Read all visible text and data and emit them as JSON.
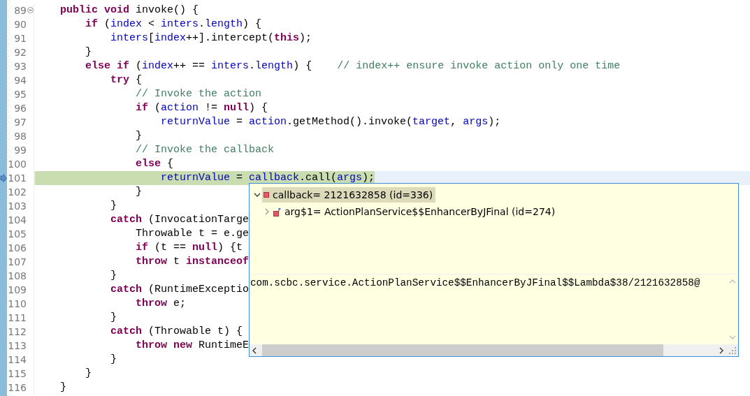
{
  "editor": {
    "lines": [
      {
        "number": "89",
        "fold": true,
        "current": false,
        "tokens": [
          {
            "kind": "kw",
            "text": "    public void"
          },
          {
            "kind": "plain",
            "text": " invoke() {"
          }
        ]
      },
      {
        "number": "90",
        "fold": false,
        "current": false,
        "tokens": [
          {
            "kind": "kw",
            "text": "        if"
          },
          {
            "kind": "plain",
            "text": " ("
          },
          {
            "kind": "field",
            "text": "index"
          },
          {
            "kind": "plain",
            "text": " < "
          },
          {
            "kind": "field",
            "text": "inters"
          },
          {
            "kind": "plain",
            "text": "."
          },
          {
            "kind": "field",
            "text": "length"
          },
          {
            "kind": "plain",
            "text": ") {"
          }
        ]
      },
      {
        "number": "91",
        "fold": false,
        "current": false,
        "tokens": [
          {
            "kind": "field",
            "text": "            inters"
          },
          {
            "kind": "plain",
            "text": "["
          },
          {
            "kind": "field",
            "text": "index"
          },
          {
            "kind": "plain",
            "text": "++].intercept("
          },
          {
            "kind": "kw",
            "text": "this"
          },
          {
            "kind": "plain",
            "text": ");"
          }
        ]
      },
      {
        "number": "92",
        "fold": false,
        "current": false,
        "tokens": [
          {
            "kind": "plain",
            "text": "        }"
          }
        ]
      },
      {
        "number": "93",
        "fold": false,
        "current": false,
        "tokens": [
          {
            "kind": "kw",
            "text": "        else if"
          },
          {
            "kind": "plain",
            "text": " ("
          },
          {
            "kind": "field",
            "text": "index"
          },
          {
            "kind": "plain",
            "text": "++ == "
          },
          {
            "kind": "field",
            "text": "inters"
          },
          {
            "kind": "plain",
            "text": "."
          },
          {
            "kind": "field",
            "text": "length"
          },
          {
            "kind": "plain",
            "text": ") {    "
          },
          {
            "kind": "comment",
            "text": "// index++ ensure invoke action only one time"
          }
        ]
      },
      {
        "number": "94",
        "fold": false,
        "current": false,
        "tokens": [
          {
            "kind": "kw",
            "text": "            try"
          },
          {
            "kind": "plain",
            "text": " {"
          }
        ]
      },
      {
        "number": "95",
        "fold": false,
        "current": false,
        "tokens": [
          {
            "kind": "comment",
            "text": "                // Invoke the action"
          }
        ]
      },
      {
        "number": "96",
        "fold": false,
        "current": false,
        "tokens": [
          {
            "kind": "kw",
            "text": "                if"
          },
          {
            "kind": "plain",
            "text": " ("
          },
          {
            "kind": "field",
            "text": "action"
          },
          {
            "kind": "plain",
            "text": " != "
          },
          {
            "kind": "kw",
            "text": "null"
          },
          {
            "kind": "plain",
            "text": ") {"
          }
        ]
      },
      {
        "number": "97",
        "fold": false,
        "current": false,
        "tokens": [
          {
            "kind": "field",
            "text": "                    returnValue"
          },
          {
            "kind": "plain",
            "text": " = "
          },
          {
            "kind": "field",
            "text": "action"
          },
          {
            "kind": "plain",
            "text": ".getMethod().invoke("
          },
          {
            "kind": "field",
            "text": "target"
          },
          {
            "kind": "plain",
            "text": ", "
          },
          {
            "kind": "field",
            "text": "args"
          },
          {
            "kind": "plain",
            "text": ");"
          }
        ]
      },
      {
        "number": "98",
        "fold": false,
        "current": false,
        "tokens": [
          {
            "kind": "plain",
            "text": "                }"
          }
        ]
      },
      {
        "number": "99",
        "fold": false,
        "current": false,
        "tokens": [
          {
            "kind": "comment",
            "text": "                // Invoke the callback"
          }
        ]
      },
      {
        "number": "100",
        "fold": false,
        "current": false,
        "tokens": [
          {
            "kind": "kw",
            "text": "                else"
          },
          {
            "kind": "plain",
            "text": " {"
          }
        ]
      },
      {
        "number": "101",
        "fold": false,
        "current": true,
        "tokens": [
          {
            "kind": "field",
            "text": "                    returnValue"
          },
          {
            "kind": "plain",
            "text": " = "
          },
          {
            "kind": "field",
            "text": "callback"
          },
          {
            "kind": "plain",
            "text": ".call("
          },
          {
            "kind": "field",
            "text": "args"
          },
          {
            "kind": "plain",
            "text": ");"
          }
        ]
      },
      {
        "number": "102",
        "fold": false,
        "current": false,
        "tokens": [
          {
            "kind": "plain",
            "text": "                }"
          }
        ]
      },
      {
        "number": "103",
        "fold": false,
        "current": false,
        "tokens": [
          {
            "kind": "plain",
            "text": "            }"
          }
        ]
      },
      {
        "number": "104",
        "fold": false,
        "current": false,
        "tokens": [
          {
            "kind": "kw",
            "text": "            catch"
          },
          {
            "kind": "plain",
            "text": " (InvocationTarge"
          }
        ]
      },
      {
        "number": "105",
        "fold": false,
        "current": false,
        "tokens": [
          {
            "kind": "plain",
            "text": "                Throwable t = e.ge"
          }
        ]
      },
      {
        "number": "106",
        "fold": false,
        "current": false,
        "tokens": [
          {
            "kind": "kw",
            "text": "                if"
          },
          {
            "kind": "plain",
            "text": " (t == "
          },
          {
            "kind": "kw",
            "text": "null"
          },
          {
            "kind": "plain",
            "text": ") {t"
          }
        ]
      },
      {
        "number": "107",
        "fold": false,
        "current": false,
        "tokens": [
          {
            "kind": "kw",
            "text": "                throw"
          },
          {
            "kind": "plain",
            "text": " t "
          },
          {
            "kind": "kw",
            "text": "instanceof"
          }
        ]
      },
      {
        "number": "108",
        "fold": false,
        "current": false,
        "tokens": [
          {
            "kind": "plain",
            "text": "            }"
          }
        ]
      },
      {
        "number": "109",
        "fold": false,
        "current": false,
        "tokens": [
          {
            "kind": "kw",
            "text": "            catch"
          },
          {
            "kind": "plain",
            "text": " (RuntimeExceptio"
          }
        ]
      },
      {
        "number": "110",
        "fold": false,
        "current": false,
        "tokens": [
          {
            "kind": "kw",
            "text": "                throw"
          },
          {
            "kind": "plain",
            "text": " e;"
          }
        ]
      },
      {
        "number": "111",
        "fold": false,
        "current": false,
        "tokens": [
          {
            "kind": "plain",
            "text": "            }"
          }
        ]
      },
      {
        "number": "112",
        "fold": false,
        "current": false,
        "tokens": [
          {
            "kind": "kw",
            "text": "            catch"
          },
          {
            "kind": "plain",
            "text": " (Throwable t) {"
          }
        ]
      },
      {
        "number": "113",
        "fold": false,
        "current": false,
        "tokens": [
          {
            "kind": "kw",
            "text": "                throw new"
          },
          {
            "kind": "plain",
            "text": " RuntimeE"
          }
        ]
      },
      {
        "number": "114",
        "fold": false,
        "current": false,
        "tokens": [
          {
            "kind": "plain",
            "text": "            }"
          }
        ]
      },
      {
        "number": "115",
        "fold": false,
        "current": false,
        "tokens": [
          {
            "kind": "plain",
            "text": "        }"
          }
        ]
      },
      {
        "number": "116",
        "fold": false,
        "current": false,
        "tokens": [
          {
            "kind": "plain",
            "text": "    }"
          }
        ]
      }
    ]
  },
  "inspect_popup": {
    "tree": [
      {
        "label": "callback= 2121632858  (id=336)",
        "kind": "object",
        "expanded": true,
        "selected": true,
        "children": [
          {
            "label": "arg$1= ActionPlanService$$EnhancerByJFinal  (id=274)",
            "kind": "field",
            "expanded": false,
            "selected": false
          }
        ]
      }
    ],
    "detail": "com.scbc.service.ActionPlanService$$EnhancerByJFinal$$Lambda$38/2121632858@"
  }
}
